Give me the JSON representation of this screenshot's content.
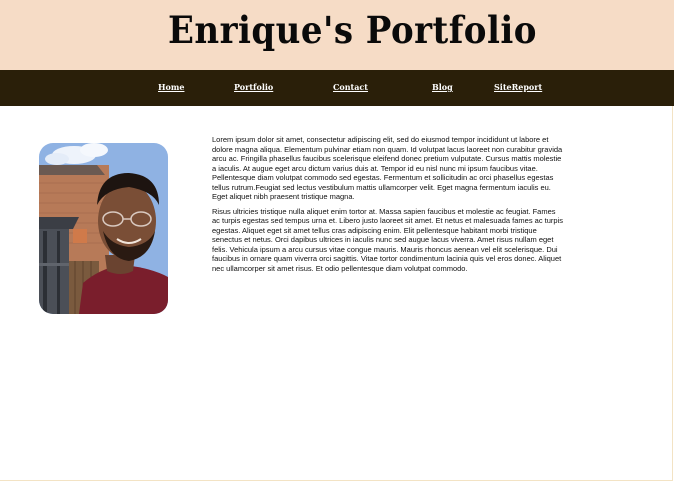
{
  "header": {
    "title": "Enrique's Portfolio"
  },
  "nav": {
    "items": [
      {
        "label": "Home"
      },
      {
        "label": "Portfolio"
      },
      {
        "label": "Contact"
      },
      {
        "label": "Blog"
      },
      {
        "label": "SiteReport"
      }
    ]
  },
  "main": {
    "photo_icon": "profile-photo",
    "paragraphs": [
      "Lorem ipsum dolor sit amet, consectetur adipiscing elit, sed do eiusmod tempor incididunt ut labore et dolore magna aliqua. Elementum pulvinar etiam non quam. Id volutpat lacus laoreet non curabitur gravida arcu ac. Fringilla phasellus faucibus scelerisque eleifend donec pretium vulputate. Cursus mattis molestie a iaculis. At augue eget arcu dictum varius duis at. Tempor id eu nisl nunc mi ipsum faucibus vitae. Pellentesque diam volutpat commodo sed egestas. Fermentum et sollicitudin ac orci phasellus egestas tellus rutrum.Feugiat sed lectus vestibulum mattis ullamcorper velit. Eget magna fermentum iaculis eu. Eget aliquet nibh praesent tristique magna.",
      "Risus ultricies tristique nulla aliquet enim tortor at. Massa sapien faucibus et molestie ac feugiat. Fames ac turpis egestas sed tempus urna et. Libero justo laoreet sit amet. Et netus et malesuada fames ac turpis egestas. Aliquet eget sit amet tellus cras adipiscing enim. Elit pellentesque habitant morbi tristique senectus et netus. Orci dapibus ultrices in iaculis nunc sed augue lacus viverra. Amet risus nullam eget felis. Vehicula ipsum a arcu cursus vitae congue mauris. Mauris rhoncus aenean vel elit scelerisque. Dui faucibus in ornare quam viverra orci sagittis. Vitae tortor condimentum lacinia quis vel eros donec. Aliquet nec ullamcorper sit amet risus. Et odio pellentesque diam volutpat commodo."
    ]
  },
  "colors": {
    "header_bg": "#f6dcc6",
    "nav_bg": "#2a1f09",
    "nav_text": "#ffffff",
    "title_text": "#0a0a0a"
  }
}
